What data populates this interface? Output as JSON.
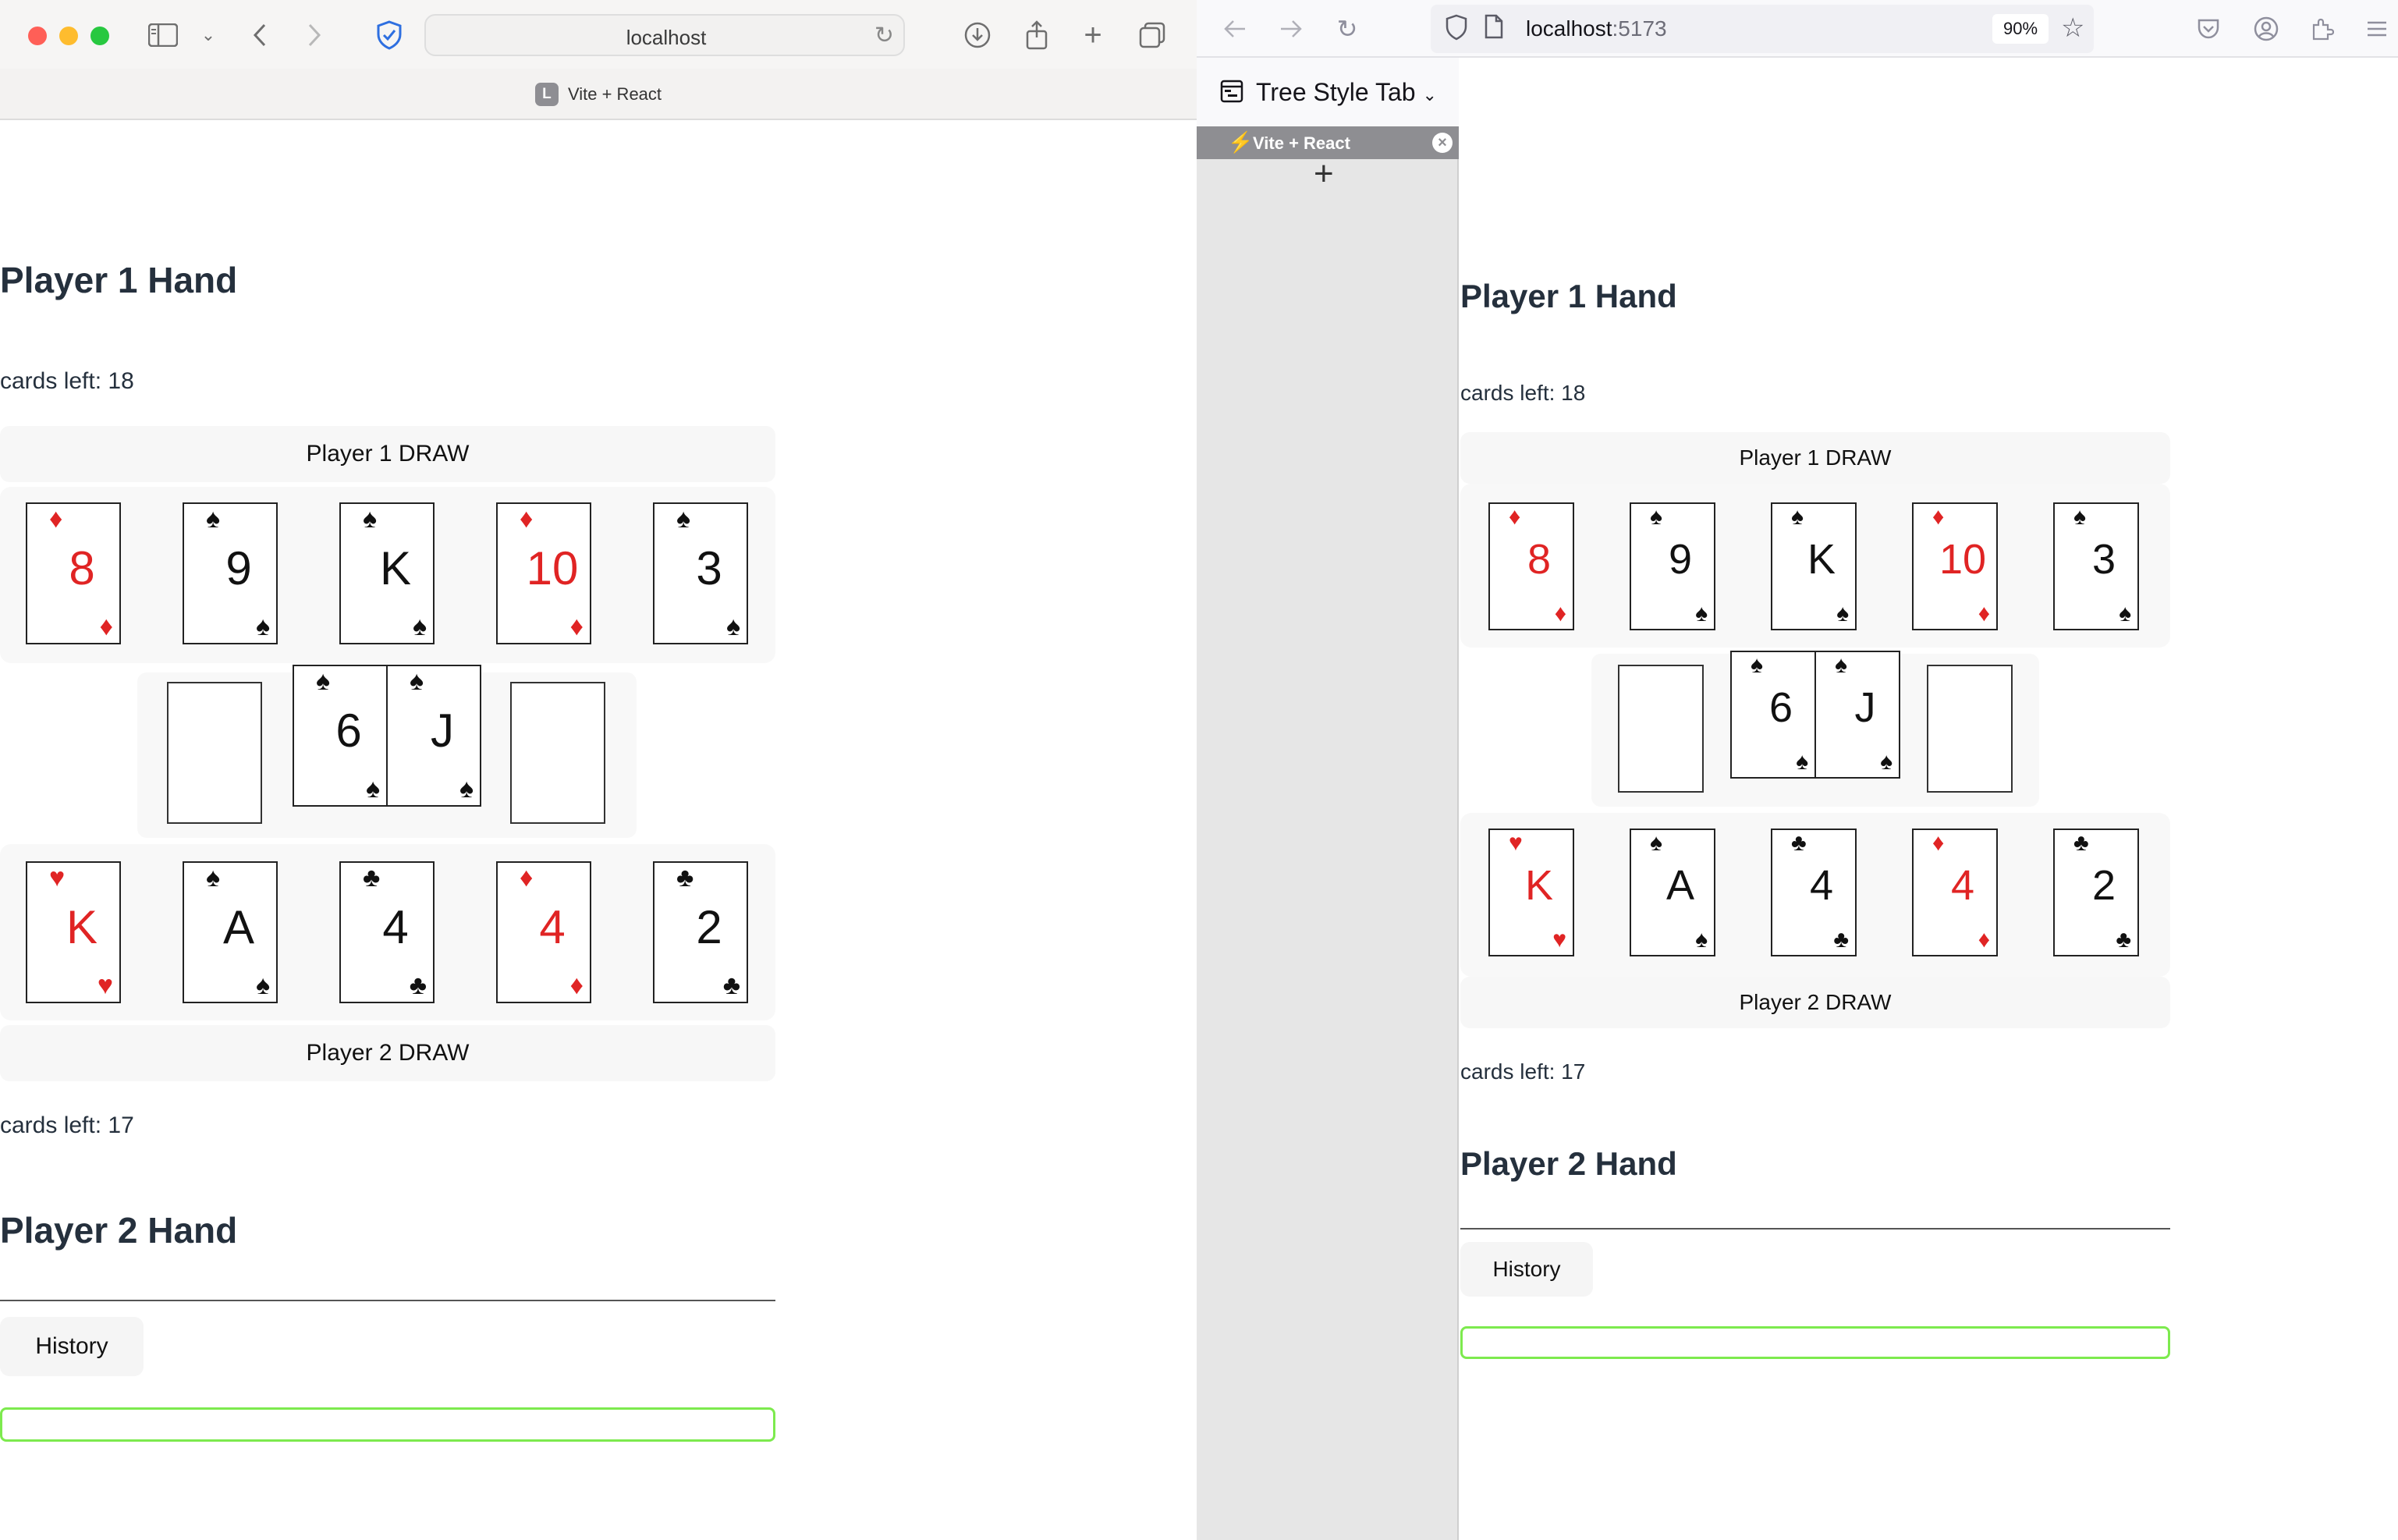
{
  "safari": {
    "url": "localhost",
    "tab_title": "Vite + React",
    "tab_favicon": "L",
    "icons": {
      "sidebar": "sidebar-icon",
      "back": "chevron-left-icon",
      "forward": "chevron-right-icon",
      "shield": "shield-icon",
      "download": "download-icon",
      "share": "share-icon",
      "new_tab": "plus-icon",
      "tabs": "tabs-icon"
    }
  },
  "firefox": {
    "url_host": "localhost",
    "url_port": ":5173",
    "zoom": "90%",
    "sidebar_title": "Tree Style Tab",
    "sidebar_tab": "Vite + React",
    "new_tab_symbol": "+"
  },
  "game": {
    "player1": {
      "heading": "Player 1 Hand",
      "cards_left": "cards left: 18",
      "draw_label": "Player 1 DRAW",
      "hand": [
        {
          "rank": "8",
          "suit": "♦",
          "color": "red"
        },
        {
          "rank": "9",
          "suit": "♠",
          "color": "black"
        },
        {
          "rank": "K",
          "suit": "♠",
          "color": "black"
        },
        {
          "rank": "10",
          "suit": "♦",
          "color": "red"
        },
        {
          "rank": "3",
          "suit": "♠",
          "color": "black"
        }
      ]
    },
    "center": {
      "cards": [
        {
          "rank": "6",
          "suit": "♠",
          "color": "black"
        },
        {
          "rank": "J",
          "suit": "♠",
          "color": "black"
        }
      ]
    },
    "player2": {
      "heading": "Player 2 Hand",
      "cards_left": "cards left: 17",
      "draw_label": "Player 2 DRAW",
      "hand": [
        {
          "rank": "K",
          "suit": "♥",
          "color": "red"
        },
        {
          "rank": "A",
          "suit": "♠",
          "color": "black"
        },
        {
          "rank": "4",
          "suit": "♣",
          "color": "black"
        },
        {
          "rank": "4",
          "suit": "♦",
          "color": "red"
        },
        {
          "rank": "2",
          "suit": "♣",
          "color": "black"
        }
      ]
    },
    "history_label": "History",
    "colors": {
      "red": "#e02424",
      "black": "#111111",
      "history_border": "#7dea4e"
    }
  }
}
